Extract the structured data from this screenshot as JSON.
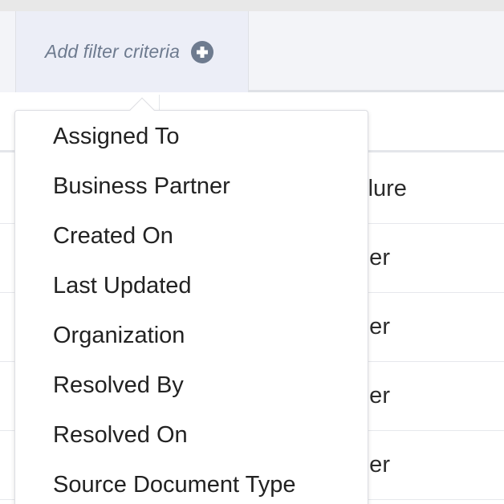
{
  "filter_bar": {
    "add_label": "Add filter criteria",
    "add_icon": "plus-circle-icon"
  },
  "table": {
    "rows": [
      {
        "visible_text": "ailure"
      },
      {
        "visible_text": "tner"
      },
      {
        "visible_text": "tner"
      },
      {
        "visible_text": "tner"
      },
      {
        "visible_text": "tner"
      }
    ]
  },
  "dropdown": {
    "items": [
      {
        "label": "Assigned To"
      },
      {
        "label": "Business Partner"
      },
      {
        "label": "Created On"
      },
      {
        "label": "Last Updated"
      },
      {
        "label": "Organization"
      },
      {
        "label": "Resolved By"
      },
      {
        "label": "Resolved On"
      },
      {
        "label": "Source Document Type"
      }
    ]
  },
  "colors": {
    "filter_bar_bg": "#f3f4f8",
    "add_cell_bg": "#eceef7",
    "add_label": "#6e7b8f",
    "plus_icon": "#6e7b8f",
    "text": "#222222"
  }
}
